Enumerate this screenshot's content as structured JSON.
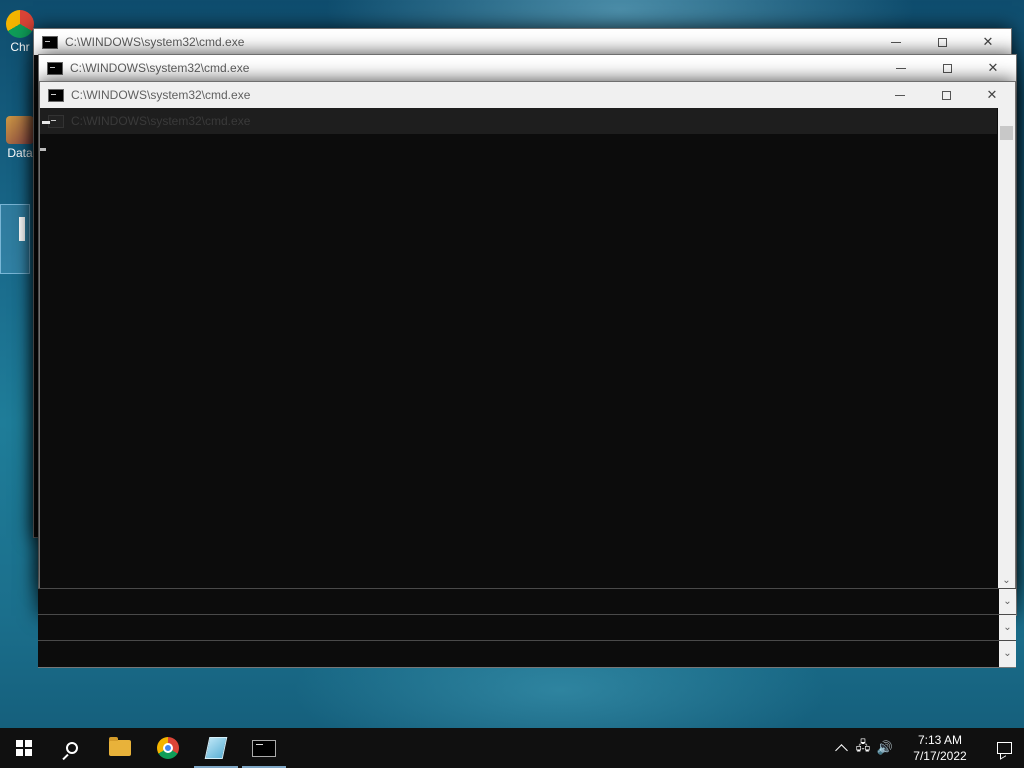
{
  "desktop": {
    "icons": [
      {
        "label": "Chr",
        "name": "chrome-shortcut"
      },
      {
        "label": "Data",
        "name": "data-shortcut"
      }
    ]
  },
  "windows": [
    {
      "title": "C:\\WINDOWS\\system32\\cmd.exe"
    },
    {
      "title": "C:\\WINDOWS\\system32\\cmd.exe"
    },
    {
      "title": "C:\\WINDOWS\\system32\\cmd.exe"
    }
  ],
  "ghost_title": "C:\\WINDOWS\\system32\\cmd.exe",
  "controls": {
    "minimize": "",
    "maximize": "",
    "close": "✕"
  },
  "scroll": {
    "down_arrow": "⌄"
  },
  "taskbar": {
    "apps": [
      "start",
      "search",
      "file-explorer",
      "chrome",
      "notepad",
      "command-prompt"
    ],
    "tray": {
      "chevron": "^",
      "network": "🖧",
      "volume": "🔊"
    },
    "time": "7:13 AM",
    "date": "7/17/2022"
  },
  "colors": {
    "console_bg": "#0c0c0c",
    "taskbar_bg": "#101010",
    "accent": "#7fa7c6"
  }
}
